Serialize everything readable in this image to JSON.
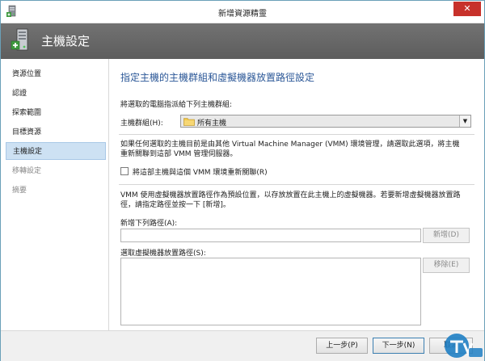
{
  "window": {
    "title": "新增資源精靈",
    "close_glyph": "✕"
  },
  "banner": {
    "title": "主機設定"
  },
  "nav": {
    "items": [
      {
        "label": "資源位置",
        "state": "normal"
      },
      {
        "label": "認證",
        "state": "normal"
      },
      {
        "label": "探索範圍",
        "state": "normal"
      },
      {
        "label": "目標資源",
        "state": "normal"
      },
      {
        "label": "主機設定",
        "state": "active"
      },
      {
        "label": "移轉設定",
        "state": "disabled"
      },
      {
        "label": "摘要",
        "state": "disabled"
      }
    ]
  },
  "main": {
    "heading": "指定主機的主機群組和虛擬機器放置路徑設定",
    "assign_text": "將選取的電腦指派給下列主機群組:",
    "host_group_label": "主機群組(H):",
    "host_group_value": "所有主機",
    "reassoc_text_line1": "如果任何選取的主機目前是由其他 Virtual Machine Manager (VMM) 環境管理，請選取此選項，將主機",
    "reassoc_text_line2": "重新關聯到這部 VMM 管理伺服器。",
    "reassoc_checkbox_label": "將這部主機與這個 VMM 環境重新關聯(R)",
    "placement_text_line1": "VMM 使用虛擬機器放置路徑作為預設位置，以存放放置在此主機上的虛擬機器。若要新增虛擬機器放置路",
    "placement_text_line2": "徑，請指定路徑並按一下 [新增]。",
    "add_path_label": "新增下列路徑(A):",
    "path_input_value": "",
    "add_button": "新增(D)",
    "paths_list_label": "選取虛擬機器放置路徑(S):",
    "remove_button": "移除(E)"
  },
  "footer": {
    "prev_button": "上一步(P)",
    "next_button": "下一步(N)",
    "cancel_button": "取消"
  },
  "colors": {
    "accent_blue": "#2b5797",
    "banner_gray": "#666666",
    "nav_active": "#cde1f3",
    "close_red": "#c7312b"
  },
  "icons": {
    "window": "server-icon",
    "banner": "server-icon",
    "host_group": "folder-icon",
    "dropdown": "chevron-down-icon",
    "close": "close-icon"
  }
}
